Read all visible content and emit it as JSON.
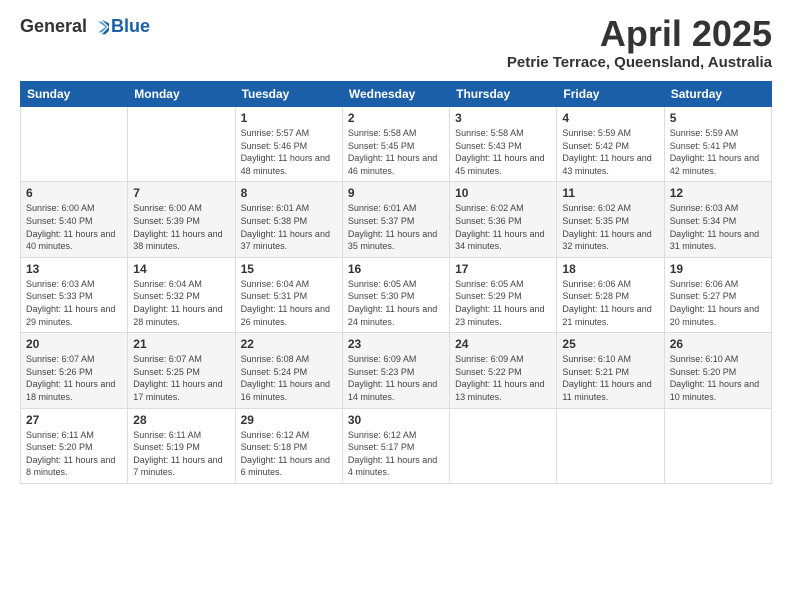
{
  "logo": {
    "general": "General",
    "blue": "Blue"
  },
  "title": "April 2025",
  "location": "Petrie Terrace, Queensland, Australia",
  "headers": [
    "Sunday",
    "Monday",
    "Tuesday",
    "Wednesday",
    "Thursday",
    "Friday",
    "Saturday"
  ],
  "weeks": [
    [
      {
        "day": "",
        "info": ""
      },
      {
        "day": "",
        "info": ""
      },
      {
        "day": "1",
        "info": "Sunrise: 5:57 AM\nSunset: 5:46 PM\nDaylight: 11 hours and 48 minutes."
      },
      {
        "day": "2",
        "info": "Sunrise: 5:58 AM\nSunset: 5:45 PM\nDaylight: 11 hours and 46 minutes."
      },
      {
        "day": "3",
        "info": "Sunrise: 5:58 AM\nSunset: 5:43 PM\nDaylight: 11 hours and 45 minutes."
      },
      {
        "day": "4",
        "info": "Sunrise: 5:59 AM\nSunset: 5:42 PM\nDaylight: 11 hours and 43 minutes."
      },
      {
        "day": "5",
        "info": "Sunrise: 5:59 AM\nSunset: 5:41 PM\nDaylight: 11 hours and 42 minutes."
      }
    ],
    [
      {
        "day": "6",
        "info": "Sunrise: 6:00 AM\nSunset: 5:40 PM\nDaylight: 11 hours and 40 minutes."
      },
      {
        "day": "7",
        "info": "Sunrise: 6:00 AM\nSunset: 5:39 PM\nDaylight: 11 hours and 38 minutes."
      },
      {
        "day": "8",
        "info": "Sunrise: 6:01 AM\nSunset: 5:38 PM\nDaylight: 11 hours and 37 minutes."
      },
      {
        "day": "9",
        "info": "Sunrise: 6:01 AM\nSunset: 5:37 PM\nDaylight: 11 hours and 35 minutes."
      },
      {
        "day": "10",
        "info": "Sunrise: 6:02 AM\nSunset: 5:36 PM\nDaylight: 11 hours and 34 minutes."
      },
      {
        "day": "11",
        "info": "Sunrise: 6:02 AM\nSunset: 5:35 PM\nDaylight: 11 hours and 32 minutes."
      },
      {
        "day": "12",
        "info": "Sunrise: 6:03 AM\nSunset: 5:34 PM\nDaylight: 11 hours and 31 minutes."
      }
    ],
    [
      {
        "day": "13",
        "info": "Sunrise: 6:03 AM\nSunset: 5:33 PM\nDaylight: 11 hours and 29 minutes."
      },
      {
        "day": "14",
        "info": "Sunrise: 6:04 AM\nSunset: 5:32 PM\nDaylight: 11 hours and 28 minutes."
      },
      {
        "day": "15",
        "info": "Sunrise: 6:04 AM\nSunset: 5:31 PM\nDaylight: 11 hours and 26 minutes."
      },
      {
        "day": "16",
        "info": "Sunrise: 6:05 AM\nSunset: 5:30 PM\nDaylight: 11 hours and 24 minutes."
      },
      {
        "day": "17",
        "info": "Sunrise: 6:05 AM\nSunset: 5:29 PM\nDaylight: 11 hours and 23 minutes."
      },
      {
        "day": "18",
        "info": "Sunrise: 6:06 AM\nSunset: 5:28 PM\nDaylight: 11 hours and 21 minutes."
      },
      {
        "day": "19",
        "info": "Sunrise: 6:06 AM\nSunset: 5:27 PM\nDaylight: 11 hours and 20 minutes."
      }
    ],
    [
      {
        "day": "20",
        "info": "Sunrise: 6:07 AM\nSunset: 5:26 PM\nDaylight: 11 hours and 18 minutes."
      },
      {
        "day": "21",
        "info": "Sunrise: 6:07 AM\nSunset: 5:25 PM\nDaylight: 11 hours and 17 minutes."
      },
      {
        "day": "22",
        "info": "Sunrise: 6:08 AM\nSunset: 5:24 PM\nDaylight: 11 hours and 16 minutes."
      },
      {
        "day": "23",
        "info": "Sunrise: 6:09 AM\nSunset: 5:23 PM\nDaylight: 11 hours and 14 minutes."
      },
      {
        "day": "24",
        "info": "Sunrise: 6:09 AM\nSunset: 5:22 PM\nDaylight: 11 hours and 13 minutes."
      },
      {
        "day": "25",
        "info": "Sunrise: 6:10 AM\nSunset: 5:21 PM\nDaylight: 11 hours and 11 minutes."
      },
      {
        "day": "26",
        "info": "Sunrise: 6:10 AM\nSunset: 5:20 PM\nDaylight: 11 hours and 10 minutes."
      }
    ],
    [
      {
        "day": "27",
        "info": "Sunrise: 6:11 AM\nSunset: 5:20 PM\nDaylight: 11 hours and 8 minutes."
      },
      {
        "day": "28",
        "info": "Sunrise: 6:11 AM\nSunset: 5:19 PM\nDaylight: 11 hours and 7 minutes."
      },
      {
        "day": "29",
        "info": "Sunrise: 6:12 AM\nSunset: 5:18 PM\nDaylight: 11 hours and 6 minutes."
      },
      {
        "day": "30",
        "info": "Sunrise: 6:12 AM\nSunset: 5:17 PM\nDaylight: 11 hours and 4 minutes."
      },
      {
        "day": "",
        "info": ""
      },
      {
        "day": "",
        "info": ""
      },
      {
        "day": "",
        "info": ""
      }
    ]
  ]
}
